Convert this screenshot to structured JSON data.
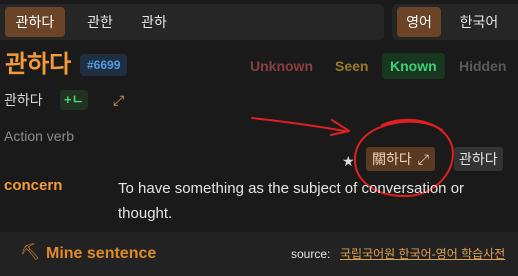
{
  "tabs_left": [
    {
      "label": "관하다",
      "active": true
    },
    {
      "label": "관한",
      "active": false
    },
    {
      "label": "관하",
      "active": false
    }
  ],
  "tabs_right": [
    {
      "label": "영어",
      "active": true
    },
    {
      "label": "한국어",
      "active": false
    }
  ],
  "headword": "관하다",
  "word_id": "#6699",
  "statuses": {
    "unknown": "Unknown",
    "seen": "Seen",
    "known": "Known",
    "hidden": "Hidden",
    "selected": "Known"
  },
  "subword": "관하다",
  "add_button": "+ㄴ",
  "part_of_speech": "Action verb",
  "hanja": {
    "label": "關하다",
    "alt_label": "관하다"
  },
  "definition": {
    "term": "concern",
    "text": "To have something as the subject of conversation or thought."
  },
  "footer": {
    "mine_label": "Mine sentence",
    "source_label": "source:",
    "source_link": "국립국어원 한국어-영어 학습사전"
  },
  "icons": {
    "expand": "expand-arrows-icon",
    "star": "star-icon",
    "mine": "pickaxe-icon"
  },
  "colors": {
    "accent": "#f59a3a",
    "known_green": "#3fd07a",
    "id_blue": "#4f9ee6",
    "annotation_red": "#e02020"
  }
}
